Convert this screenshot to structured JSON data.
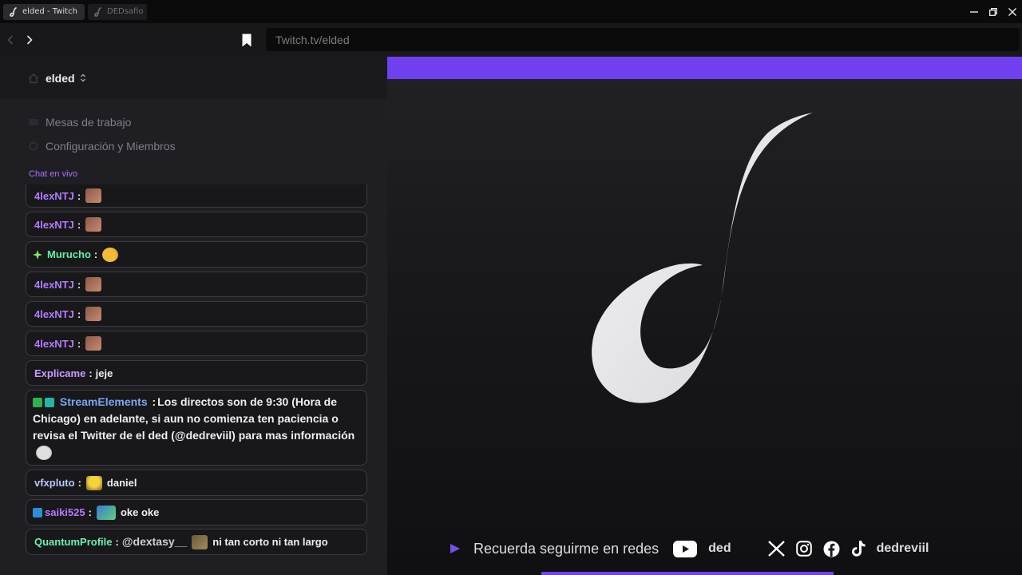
{
  "tabs": [
    {
      "label": "elded - Twitch",
      "active": true
    },
    {
      "label": "DEDsafio",
      "active": false
    }
  ],
  "url": "Twitch.tv/elded",
  "workspace": {
    "name": "elded"
  },
  "menu": {
    "workbenches": "Mesas de trabajo",
    "settings": "Configuración y Miembros"
  },
  "chat_label": "Chat en vivo",
  "chat": [
    {
      "user": "4lexNTJ",
      "color": "#b57bff",
      "text": "",
      "emote": true,
      "badge": null
    },
    {
      "user": "4lexNTJ",
      "color": "#b57bff",
      "text": "",
      "emote": true,
      "badge": null
    },
    {
      "user": "Murucho",
      "color": "#5ef0a8",
      "text": "",
      "emote": true,
      "badge": "green-plus"
    },
    {
      "user": "4lexNTJ",
      "color": "#b57bff",
      "text": "",
      "emote": true,
      "badge": null
    },
    {
      "user": "4lexNTJ",
      "color": "#b57bff",
      "text": "",
      "emote": true,
      "badge": null
    },
    {
      "user": "4lexNTJ",
      "color": "#b57bff",
      "text": "",
      "emote": true,
      "badge": null
    },
    {
      "user": "Explicame",
      "color": "#c89cff",
      "text": "jeje",
      "emote": false,
      "badge": null
    },
    {
      "user": "StreamElements",
      "color": "#7aa7f5",
      "text": "Los directos son de 9:30 (Hora de Chicago) en adelante, si aun no comienza ten paciencia o revisa el Twitter de el ded (@dedreviil) para mas información",
      "emote": true,
      "badge": "mod"
    },
    {
      "user": "vfxpluto",
      "color": "#b8c6ff",
      "text": "daniel",
      "emote": true,
      "badge": null
    },
    {
      "user": "saiki525",
      "color": "#b57bff",
      "text": "oke oke",
      "emote": true,
      "badge": "prime"
    },
    {
      "user": "QuantumProfile",
      "color": "#6af0b0",
      "mention": "@dextasy__",
      "text": "ni tan corto ni tan largo",
      "emote": true,
      "badge": null
    }
  ],
  "stream": {
    "social_prompt": "Recuerda seguirme en redes",
    "youtube_handle": "ded",
    "social_handle": "dedreviil",
    "accent": "#7040f0"
  }
}
